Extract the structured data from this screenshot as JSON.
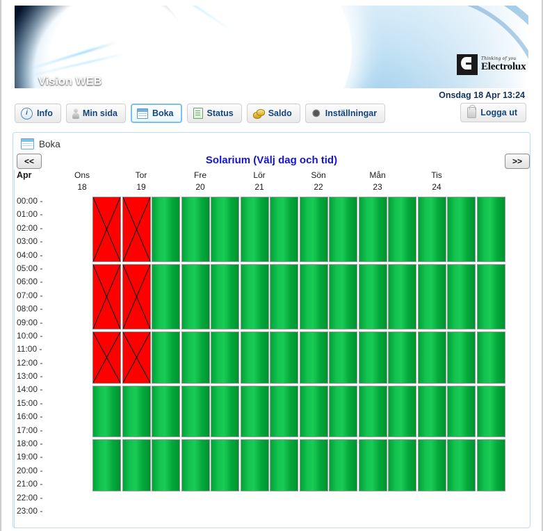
{
  "app": {
    "banner_title": "Vision WEB",
    "logo_tagline": "Thinking of you",
    "logo_name": "Electrolux"
  },
  "header": {
    "datetime": "Onsdag 18 Apr 13:24",
    "logout_label": "Logga ut",
    "logout_icon": "lock-icon"
  },
  "nav": {
    "items": [
      {
        "label": "Info",
        "icon": "info-icon",
        "active": false
      },
      {
        "label": "Min sida",
        "icon": "user-icon",
        "active": false
      },
      {
        "label": "Boka",
        "icon": "calendar-icon",
        "active": true
      },
      {
        "label": "Status",
        "icon": "list-icon",
        "active": false
      },
      {
        "label": "Saldo",
        "icon": "coins-icon",
        "active": false
      },
      {
        "label": "Inställningar",
        "icon": "gear-icon",
        "active": false
      }
    ]
  },
  "panel": {
    "header_label": "Boka",
    "header_icon": "calendar-icon",
    "calendar_title": "Solarium (Välj dag och tid)",
    "prev_label": "<<",
    "next_label": ">>",
    "month_label": "Apr"
  },
  "calendar": {
    "days": [
      {
        "name": "Ons",
        "num": "18"
      },
      {
        "name": "Tor",
        "num": "19"
      },
      {
        "name": "Fre",
        "num": "20"
      },
      {
        "name": "Lör",
        "num": "21"
      },
      {
        "name": "Sön",
        "num": "22"
      },
      {
        "name": "Mån",
        "num": "23"
      },
      {
        "name": "Tis",
        "num": "24"
      }
    ],
    "times": [
      "00:00 -",
      "01:00 -",
      "02:00 -",
      "03:00 -",
      "04:00 -",
      "05:00 -",
      "06:00 -",
      "07:00 -",
      "08:00 -",
      "09:00 -",
      "10:00 -",
      "11:00 -",
      "12:00 -",
      "13:00 -",
      "14:00 -",
      "15:00 -",
      "16:00 -",
      "17:00 -",
      "18:00 -",
      "19:00 -",
      "20:00 -",
      "21:00 -",
      "22:00 -",
      "23:00 -"
    ],
    "legend": {
      "free_color": "#12c24e",
      "booked_color": "#fe0000"
    },
    "blocks": [
      {
        "start": "00:00",
        "end": "04:00",
        "hours": 4
      },
      {
        "start": "05:00",
        "end": "09:00",
        "hours": 4
      },
      {
        "start": "10:00",
        "end": "13:00",
        "hours": 3
      },
      {
        "start": "14:00",
        "end": "17:00",
        "hours": 3
      },
      {
        "start": "18:00",
        "end": "21:00",
        "hours": 3
      }
    ],
    "slots_per_block": 2,
    "day_states": [
      {
        "day": "Ons 18",
        "blocks": [
          "booked",
          "booked",
          "booked",
          "free",
          "free"
        ]
      },
      {
        "day": "Tor 19",
        "blocks": [
          "free",
          "free",
          "free",
          "free",
          "free"
        ]
      },
      {
        "day": "Fre 20",
        "blocks": [
          "free",
          "free",
          "free",
          "free",
          "free"
        ]
      },
      {
        "day": "Lör 21",
        "blocks": [
          "free",
          "free",
          "free",
          "free",
          "free"
        ]
      },
      {
        "day": "Sön 22",
        "blocks": [
          "free",
          "free",
          "free",
          "free",
          "free"
        ]
      },
      {
        "day": "Mån 23",
        "blocks": [
          "free",
          "free",
          "free",
          "free",
          "free"
        ]
      },
      {
        "day": "Tis 24",
        "blocks": [
          "free",
          "free",
          "free",
          "free",
          "free"
        ]
      }
    ]
  }
}
